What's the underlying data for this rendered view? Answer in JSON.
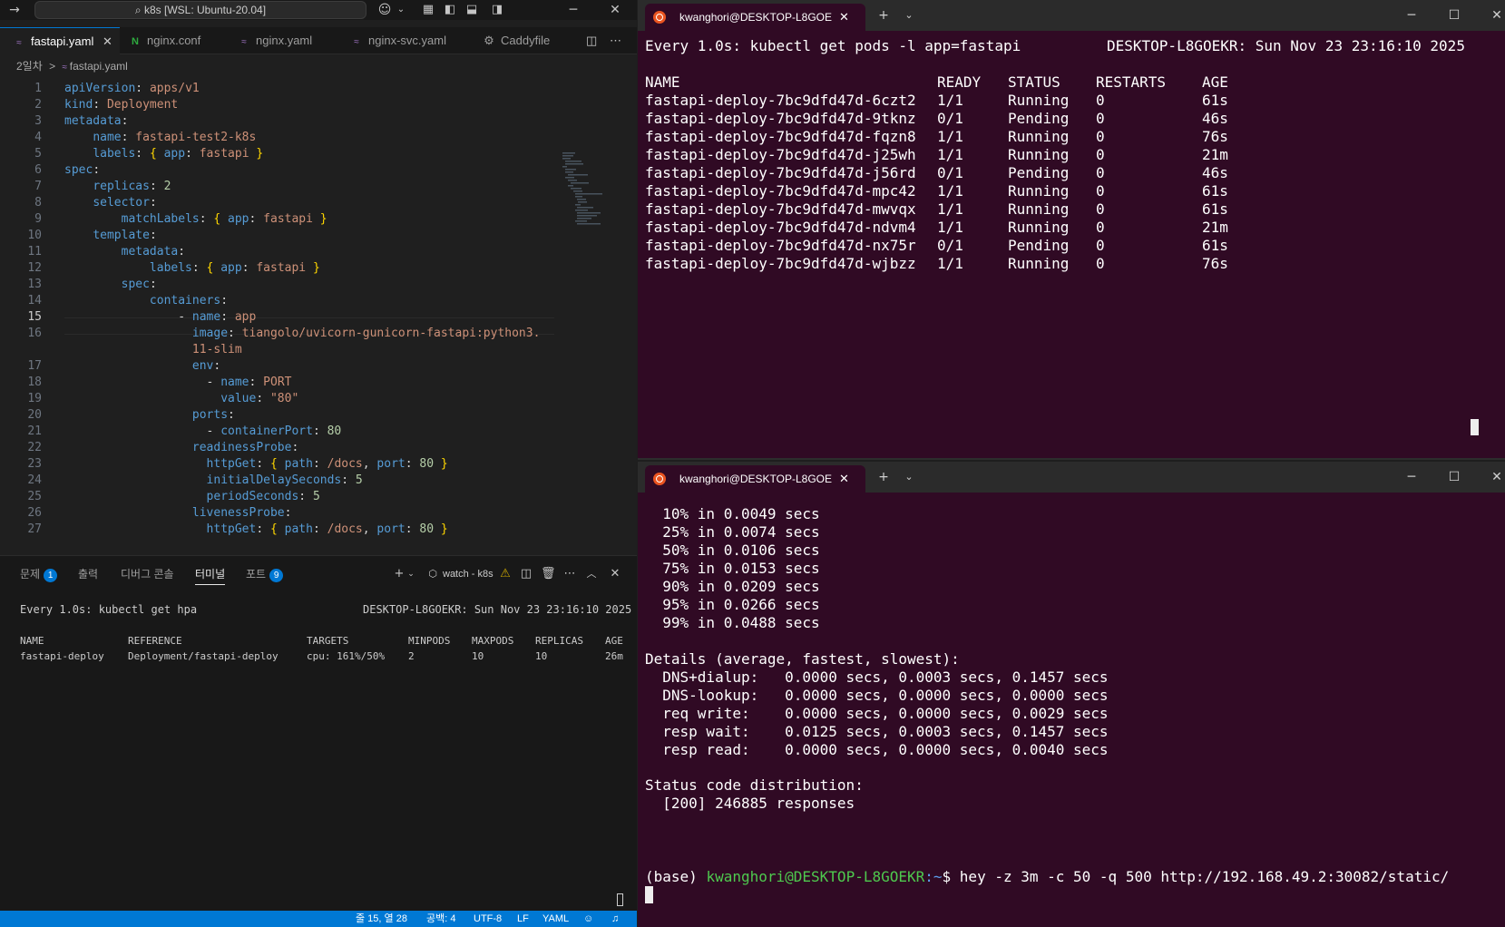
{
  "vscode": {
    "command_center": "k8s [WSL: Ubuntu-20.04]",
    "tabs": [
      {
        "label": "fastapi.yaml",
        "close": "✕"
      },
      {
        "label": "nginx.conf"
      },
      {
        "label": "nginx.yaml"
      },
      {
        "label": "nginx-svc.yaml"
      },
      {
        "label": "Caddyfile"
      }
    ],
    "breadcrumb": {
      "folder": "2일차",
      "separator": ">",
      "file": "fastapi.yaml"
    },
    "code_lines": [
      {
        "num": "1",
        "parts": [
          [
            "k",
            "apiVersion"
          ],
          [
            "p",
            ": "
          ],
          [
            "v",
            "apps/v1"
          ]
        ]
      },
      {
        "num": "2",
        "parts": [
          [
            "k",
            "kind"
          ],
          [
            "p",
            ": "
          ],
          [
            "v",
            "Deployment"
          ]
        ]
      },
      {
        "num": "3",
        "parts": [
          [
            "k",
            "metadata"
          ],
          [
            "p",
            ":"
          ]
        ]
      },
      {
        "num": "4",
        "parts": [
          [
            "p",
            "    "
          ],
          [
            "k",
            "name"
          ],
          [
            "p",
            ": "
          ],
          [
            "v",
            "fastapi-test2-k8s"
          ]
        ]
      },
      {
        "num": "5",
        "parts": [
          [
            "p",
            "    "
          ],
          [
            "k",
            "labels"
          ],
          [
            "p",
            ": "
          ],
          [
            "b",
            "{ "
          ],
          [
            "k",
            "app"
          ],
          [
            "p",
            ": "
          ],
          [
            "v",
            "fastapi"
          ],
          [
            "b",
            " }"
          ]
        ]
      },
      {
        "num": "6",
        "parts": [
          [
            "k",
            "spec"
          ],
          [
            "p",
            ":"
          ]
        ]
      },
      {
        "num": "7",
        "parts": [
          [
            "p",
            "    "
          ],
          [
            "k",
            "replicas"
          ],
          [
            "p",
            ": "
          ],
          [
            "n",
            "2"
          ]
        ]
      },
      {
        "num": "8",
        "parts": [
          [
            "p",
            "    "
          ],
          [
            "k",
            "selector"
          ],
          [
            "p",
            ":"
          ]
        ]
      },
      {
        "num": "9",
        "parts": [
          [
            "p",
            "        "
          ],
          [
            "k",
            "matchLabels"
          ],
          [
            "p",
            ": "
          ],
          [
            "b",
            "{ "
          ],
          [
            "k",
            "app"
          ],
          [
            "p",
            ": "
          ],
          [
            "v",
            "fastapi"
          ],
          [
            "b",
            " }"
          ]
        ]
      },
      {
        "num": "10",
        "parts": [
          [
            "p",
            "    "
          ],
          [
            "k",
            "template"
          ],
          [
            "p",
            ":"
          ]
        ]
      },
      {
        "num": "11",
        "parts": [
          [
            "p",
            "        "
          ],
          [
            "k",
            "metadata"
          ],
          [
            "p",
            ":"
          ]
        ]
      },
      {
        "num": "12",
        "parts": [
          [
            "p",
            "            "
          ],
          [
            "k",
            "labels"
          ],
          [
            "p",
            ": "
          ],
          [
            "b",
            "{ "
          ],
          [
            "k",
            "app"
          ],
          [
            "p",
            ": "
          ],
          [
            "v",
            "fastapi"
          ],
          [
            "b",
            " }"
          ]
        ]
      },
      {
        "num": "13",
        "parts": [
          [
            "p",
            "        "
          ],
          [
            "k",
            "spec"
          ],
          [
            "p",
            ":"
          ]
        ]
      },
      {
        "num": "14",
        "parts": [
          [
            "p",
            "            "
          ],
          [
            "k",
            "containers"
          ],
          [
            "p",
            ":"
          ]
        ]
      },
      {
        "num": "15",
        "parts": [
          [
            "p",
            "                "
          ],
          [
            "p",
            "- "
          ],
          [
            "k",
            "name"
          ],
          [
            "p",
            ": "
          ],
          [
            "v",
            "app"
          ]
        ]
      },
      {
        "num": "16",
        "parts": [
          [
            "p",
            "                  "
          ],
          [
            "k",
            "image"
          ],
          [
            "p",
            ": "
          ],
          [
            "v",
            "tiangolo/uvicorn-gunicorn-fastapi:python3."
          ]
        ]
      },
      {
        "num": "",
        "parts": [
          [
            "p",
            "                  "
          ],
          [
            "v",
            "11-slim"
          ]
        ]
      },
      {
        "num": "17",
        "parts": [
          [
            "p",
            "                  "
          ],
          [
            "k",
            "env"
          ],
          [
            "p",
            ":"
          ]
        ]
      },
      {
        "num": "18",
        "parts": [
          [
            "p",
            "                    "
          ],
          [
            "p",
            "- "
          ],
          [
            "k",
            "name"
          ],
          [
            "p",
            ": "
          ],
          [
            "v",
            "PORT"
          ]
        ]
      },
      {
        "num": "19",
        "parts": [
          [
            "p",
            "                      "
          ],
          [
            "k",
            "value"
          ],
          [
            "p",
            ": "
          ],
          [
            "v",
            "\"80\""
          ]
        ]
      },
      {
        "num": "20",
        "parts": [
          [
            "p",
            "                  "
          ],
          [
            "k",
            "ports"
          ],
          [
            "p",
            ":"
          ]
        ]
      },
      {
        "num": "21",
        "parts": [
          [
            "p",
            "                    "
          ],
          [
            "p",
            "- "
          ],
          [
            "k",
            "containerPort"
          ],
          [
            "p",
            ": "
          ],
          [
            "n",
            "80"
          ]
        ]
      },
      {
        "num": "22",
        "parts": [
          [
            "p",
            "                  "
          ],
          [
            "k",
            "readinessProbe"
          ],
          [
            "p",
            ":"
          ]
        ]
      },
      {
        "num": "23",
        "parts": [
          [
            "p",
            "                    "
          ],
          [
            "k",
            "httpGet"
          ],
          [
            "p",
            ": "
          ],
          [
            "b",
            "{ "
          ],
          [
            "k",
            "path"
          ],
          [
            "p",
            ": "
          ],
          [
            "v",
            "/docs"
          ],
          [
            "p",
            ", "
          ],
          [
            "k",
            "port"
          ],
          [
            "p",
            ": "
          ],
          [
            "n",
            "80"
          ],
          [
            "b",
            " }"
          ]
        ]
      },
      {
        "num": "24",
        "parts": [
          [
            "p",
            "                    "
          ],
          [
            "k",
            "initialDelaySeconds"
          ],
          [
            "p",
            ": "
          ],
          [
            "n",
            "5"
          ]
        ]
      },
      {
        "num": "25",
        "parts": [
          [
            "p",
            "                    "
          ],
          [
            "k",
            "periodSeconds"
          ],
          [
            "p",
            ": "
          ],
          [
            "n",
            "5"
          ]
        ]
      },
      {
        "num": "26",
        "parts": [
          [
            "p",
            "                  "
          ],
          [
            "k",
            "livenessProbe"
          ],
          [
            "p",
            ":"
          ]
        ]
      },
      {
        "num": "27",
        "parts": [
          [
            "p",
            "                    "
          ],
          [
            "k",
            "httpGet"
          ],
          [
            "p",
            ": "
          ],
          [
            "b",
            "{ "
          ],
          [
            "k",
            "path"
          ],
          [
            "p",
            ": "
          ],
          [
            "v",
            "/docs"
          ],
          [
            "p",
            ", "
          ],
          [
            "k",
            "port"
          ],
          [
            "p",
            ": "
          ],
          [
            "n",
            "80"
          ],
          [
            "b",
            " }"
          ]
        ]
      }
    ],
    "panel": {
      "tabs": [
        {
          "label": "문제",
          "badge": "1"
        },
        {
          "label": "출력"
        },
        {
          "label": "디버그 콘솔"
        },
        {
          "label": "터미널"
        },
        {
          "label": "포트",
          "badge": "9"
        }
      ],
      "terminal_name": "watch - k8s",
      "watch_header": "Every 1.0s: kubectl get hpa",
      "watch_host": "DESKTOP-L8GOEKR: Sun Nov 23 23:16:10 2025",
      "hpa_headers": [
        "NAME",
        "REFERENCE",
        "TARGETS",
        "MINPODS",
        "MAXPODS",
        "REPLICAS",
        "AGE"
      ],
      "hpa_row": [
        "fastapi-deploy",
        "Deployment/fastapi-deploy",
        "cpu: 161%/50%",
        "2",
        "10",
        "10",
        "26m"
      ]
    },
    "status": {
      "position": "줄 15, 열 28",
      "spaces": "공백: 4",
      "encoding": "UTF-8",
      "eol": "LF",
      "language": "YAML"
    }
  },
  "terminal_top": {
    "tab_title": "kwanghori@DESKTOP-L8GOE",
    "header_cmd": "Every 1.0s: kubectl get pods -l app=fastapi",
    "header_host": "DESKTOP-L8GOEKR: Sun Nov 23 23:16:10 2025",
    "columns": [
      "NAME",
      "READY",
      "STATUS",
      "RESTARTS",
      "AGE"
    ],
    "pods": [
      [
        "fastapi-deploy-7bc9dfd47d-6czt2",
        "1/1",
        "Running",
        "0",
        "61s"
      ],
      [
        "fastapi-deploy-7bc9dfd47d-9tknz",
        "0/1",
        "Pending",
        "0",
        "46s"
      ],
      [
        "fastapi-deploy-7bc9dfd47d-fqzn8",
        "1/1",
        "Running",
        "0",
        "76s"
      ],
      [
        "fastapi-deploy-7bc9dfd47d-j25wh",
        "1/1",
        "Running",
        "0",
        "21m"
      ],
      [
        "fastapi-deploy-7bc9dfd47d-j56rd",
        "0/1",
        "Pending",
        "0",
        "46s"
      ],
      [
        "fastapi-deploy-7bc9dfd47d-mpc42",
        "1/1",
        "Running",
        "0",
        "61s"
      ],
      [
        "fastapi-deploy-7bc9dfd47d-mwvqx",
        "1/1",
        "Running",
        "0",
        "61s"
      ],
      [
        "fastapi-deploy-7bc9dfd47d-ndvm4",
        "1/1",
        "Running",
        "0",
        "21m"
      ],
      [
        "fastapi-deploy-7bc9dfd47d-nx75r",
        "0/1",
        "Pending",
        "0",
        "61s"
      ],
      [
        "fastapi-deploy-7bc9dfd47d-wjbzz",
        "1/1",
        "Running",
        "0",
        "76s"
      ]
    ]
  },
  "terminal_bottom": {
    "tab_title": "kwanghori@DESKTOP-L8GOE",
    "latency": [
      "  10% in 0.0049 secs",
      "  25% in 0.0074 secs",
      "  50% in 0.0106 secs",
      "  75% in 0.0153 secs",
      "  90% in 0.0209 secs",
      "  95% in 0.0266 secs",
      "  99% in 0.0488 secs"
    ],
    "details_title": "Details (average, fastest, slowest):",
    "details": [
      "  DNS+dialup:   0.0000 secs, 0.0003 secs, 0.1457 secs",
      "  DNS-lookup:   0.0000 secs, 0.0000 secs, 0.0000 secs",
      "  req write:    0.0000 secs, 0.0000 secs, 0.0029 secs",
      "  resp wait:    0.0125 secs, 0.0003 secs, 0.1457 secs",
      "  resp read:    0.0000 secs, 0.0000 secs, 0.0040 secs"
    ],
    "status_title": "Status code distribution:",
    "status_line": "  [200] 246885 responses",
    "prompt_env": "(base) ",
    "prompt_user": "kwanghori@DESKTOP-L8GOEKR",
    "prompt_path": ":~",
    "prompt_cmd": "$ hey -z 3m -c 50 -q 500 http://192.168.49.2:30082/static/"
  },
  "colors": {
    "terminal_bg": "#300a24",
    "vscode_bg": "#1f1f1f",
    "status_bar": "#0078d4",
    "prompt_green": "#4ec94e",
    "ubuntu_orange": "#e95420"
  },
  "icons": [
    "back-arrow-icon",
    "search-icon",
    "copilot-icon",
    "layout-icon",
    "split-editor-icon",
    "more-icon",
    "gear-icon",
    "plus-icon",
    "chevron-down-icon",
    "warning-icon",
    "trash-icon",
    "close-icon",
    "bell-icon",
    "minimize-icon",
    "maximize-icon"
  ]
}
